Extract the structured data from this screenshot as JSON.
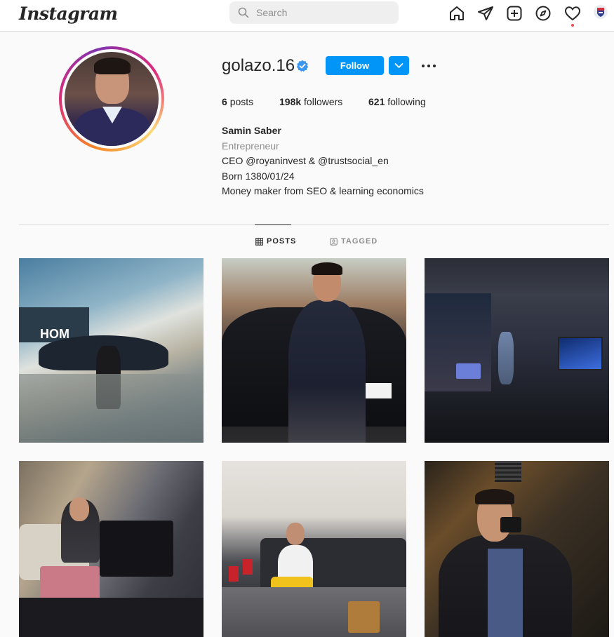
{
  "app": {
    "logo_text": "Instagram"
  },
  "search": {
    "placeholder": "Search"
  },
  "nav": {
    "icons": [
      "home-icon",
      "direct-message-icon",
      "new-post-icon",
      "explore-icon",
      "activity-heart-icon",
      "profile-avatar-icon"
    ]
  },
  "profile": {
    "username": "golazo.16",
    "verified": true,
    "follow_label": "Follow",
    "stats": {
      "posts_count": "6",
      "posts_label": "posts",
      "followers_count": "198k",
      "followers_label": "followers",
      "following_count": "621",
      "following_label": "following"
    },
    "bio": {
      "name": "Samin Saber",
      "category": "Entrepreneur",
      "line1": "CEO @royaninvest & @trustsocial_en",
      "line2": "Born 1380/01/24",
      "line3": "Money maker from SEO & learning economics"
    }
  },
  "tabs": {
    "posts_label": "POSTS",
    "tagged_label": "TAGGED",
    "active": "POSTS"
  },
  "colors": {
    "accent": "#0095f6",
    "text": "#262626",
    "muted": "#8e8e8e",
    "background": "#fafafa",
    "border": "#dbdbdb",
    "notification_dot": "#ed4956"
  },
  "posts": [
    {
      "id": "post-1",
      "description_icon": "car-photo"
    },
    {
      "id": "post-2",
      "description_icon": "portrait-photo"
    },
    {
      "id": "post-3",
      "description_icon": "room-photo"
    },
    {
      "id": "post-4",
      "description_icon": "desk-photo"
    },
    {
      "id": "post-5",
      "description_icon": "cafe-photo"
    },
    {
      "id": "post-6",
      "description_icon": "mirror-selfie-photo"
    }
  ]
}
